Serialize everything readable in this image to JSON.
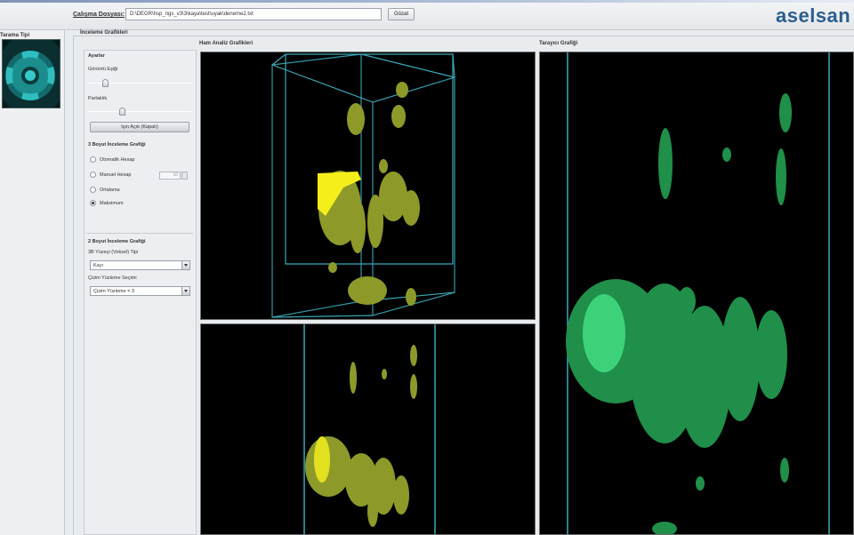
{
  "header": {
    "file_label": "Çalışma Dosyası:",
    "file_path": "D:\\DEGR\\hsp_ngs_v3\\3\\kaya\\test\\uyak\\deneme2.txt",
    "browse_label": "Gözat",
    "logo": "aselsan"
  },
  "left_panel": {
    "title": "Tarama Tipi"
  },
  "group": {
    "title": "İnceleme Grafikleri"
  },
  "controls": {
    "settings_title": "Ayarlar",
    "brightness_label": "Görüntü Eşiği",
    "brightness_value": 0.15,
    "zoom_label": "Parlaklık",
    "zoom_value": 0.32,
    "action_button": "Işın Açık (Kapalı)",
    "section_3d_title": "3 Boyut İnceleme Grafiği",
    "radio_options": [
      "Otomatik Hesap",
      "Manuel Hesap",
      "Ortalama",
      "Maksimum"
    ],
    "radio_selected": 3,
    "spin_value": "10",
    "section_2d_title": "2 Boyut İnceleme Grafiği",
    "combo1_label": "3B Yüzeyi (Voksel) Tipi",
    "combo1_value": "Kayı",
    "combo2_label": "Çizim Yüzleme Seçimi",
    "combo2_value": "Çizim Yüzleme = 3"
  },
  "views": {
    "top_left_title": "Ham Analiz Grafikleri",
    "right_title": "Tarayıcı Grafiği"
  },
  "colors": {
    "yellow_blob": "#8d9a2a",
    "yellow_bright": "#f4ef1a",
    "green_blob": "#1f8f4a",
    "green_bright": "#3dd27a",
    "wireframe": "#3aa9b8"
  }
}
